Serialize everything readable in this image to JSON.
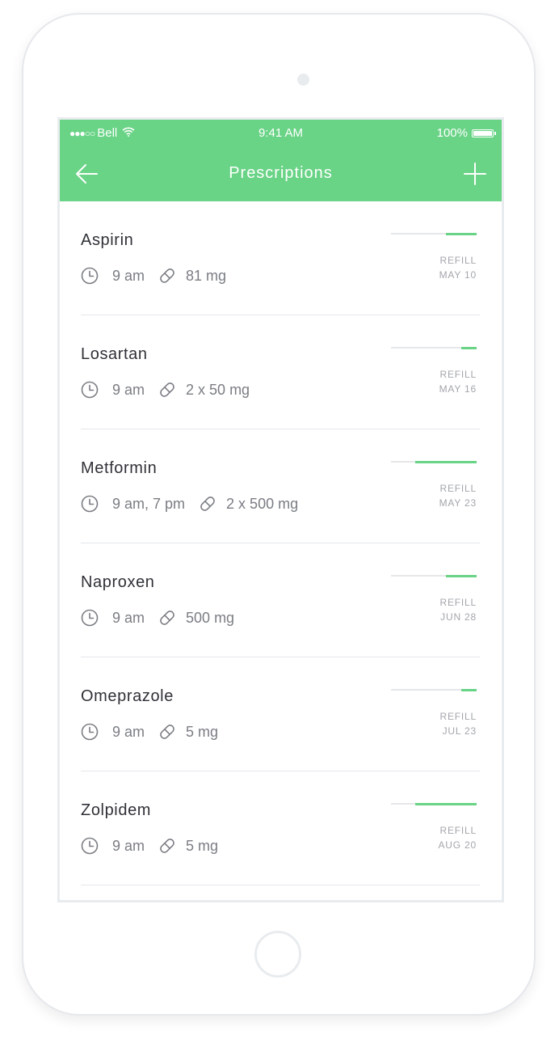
{
  "status_bar": {
    "carrier": "Bell",
    "signal_dots": "●●●○○",
    "time": "9:41 AM",
    "battery": "100%"
  },
  "nav": {
    "title": "Prescriptions",
    "back_icon": "arrow-left-icon",
    "add_icon": "plus-icon"
  },
  "colors": {
    "accent": "#69d386",
    "text": "#2f3137",
    "muted": "#7a7d83",
    "divider": "#e5e7ea"
  },
  "prescriptions": [
    {
      "name": "Aspirin",
      "time": "9 am",
      "dose": "81 mg",
      "refill_label": "REFILL",
      "refill_date": "MAY 10",
      "progress": 0.36
    },
    {
      "name": "Losartan",
      "time": "9 am",
      "dose": "2 x 50 mg",
      "refill_label": "REFILL",
      "refill_date": "MAY 16",
      "progress": 0.18
    },
    {
      "name": "Metformin",
      "time": "9 am, 7 pm",
      "dose": "2 x 500 mg",
      "refill_label": "REFILL",
      "refill_date": "MAY 23",
      "progress": 0.72
    },
    {
      "name": "Naproxen",
      "time": "9 am",
      "dose": "500 mg",
      "refill_label": "REFILL",
      "refill_date": "JUN 28",
      "progress": 0.36
    },
    {
      "name": "Omeprazole",
      "time": "9 am",
      "dose": "5 mg",
      "refill_label": "REFILL",
      "refill_date": "JUL 23",
      "progress": 0.18
    },
    {
      "name": "Zolpidem",
      "time": "9 am",
      "dose": "5 mg",
      "refill_label": "REFILL",
      "refill_date": "AUG 20",
      "progress": 0.72
    }
  ]
}
